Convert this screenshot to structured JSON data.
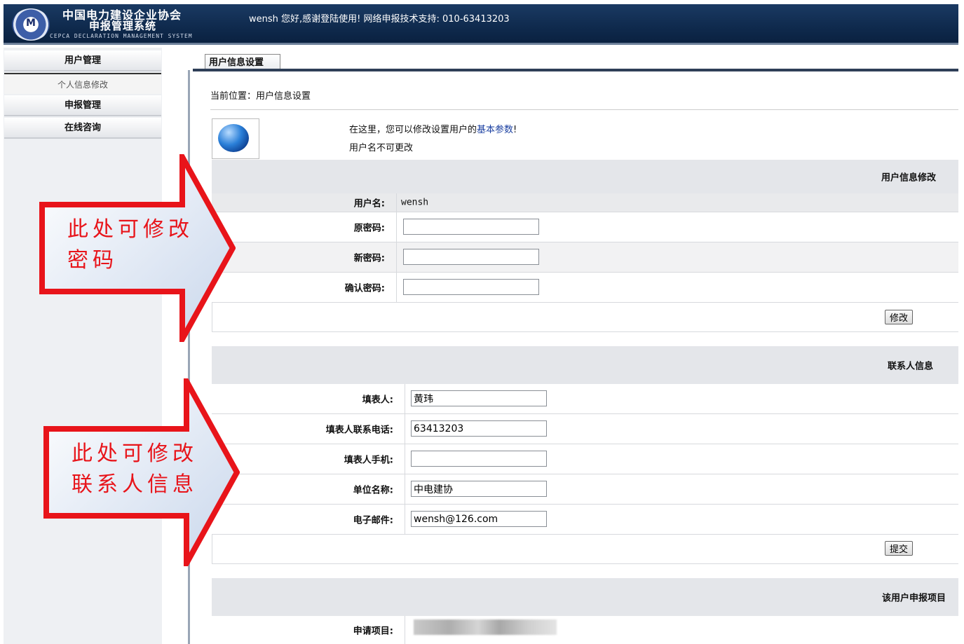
{
  "header": {
    "title_line1": "中国电力建设企业协会",
    "title_line2": "申报管理系统",
    "subtitle": "CEPCA DECLARATION MANAGEMENT SYSTEM",
    "welcome": "wensh 您好,感谢登陆使用! 网络申报技术支持: 010-63413203"
  },
  "sidebar": {
    "items": [
      {
        "label": "用户管理"
      },
      {
        "label": "个人信息修改"
      },
      {
        "label": "申报管理"
      },
      {
        "label": "在线咨询"
      }
    ]
  },
  "main": {
    "tab": "用户信息设置",
    "breadcrumb": "当前位置：用户信息设置",
    "info_line1_prefix": "在这里，您可以修改设置用户的",
    "info_line1_link": "基本参数",
    "info_line1_suffix": "!",
    "info_line2": "用户名不可更改",
    "user_section": {
      "title": "用户信息修改",
      "username_label": "用户名:",
      "username_value": "wensh",
      "old_password_label": "原密码:",
      "new_password_label": "新密码:",
      "confirm_password_label": "确认密码:",
      "submit": "修改"
    },
    "contact_section": {
      "title": "联系人信息",
      "fields": [
        {
          "label": "填表人:",
          "value": "黄玮"
        },
        {
          "label": "填表人联系电话:",
          "value": "63413203"
        },
        {
          "label": "填表人手机:",
          "value": ""
        },
        {
          "label": "单位名称:",
          "value": "中电建协"
        },
        {
          "label": "电子邮件:",
          "value": "wensh@126.com"
        }
      ],
      "submit": "提交"
    },
    "project_section": {
      "title": "该用户申报项目",
      "project_label": "申请项目:"
    }
  },
  "callouts": {
    "password_line1": "此处可修改",
    "password_line2": "密码",
    "contact_line1": "此处可修改",
    "contact_line2": "联系人信息"
  },
  "colors": {
    "header_bg": "#0f2a4d",
    "callout_red": "#e8141a",
    "section_bg": "#e4e6ea"
  }
}
